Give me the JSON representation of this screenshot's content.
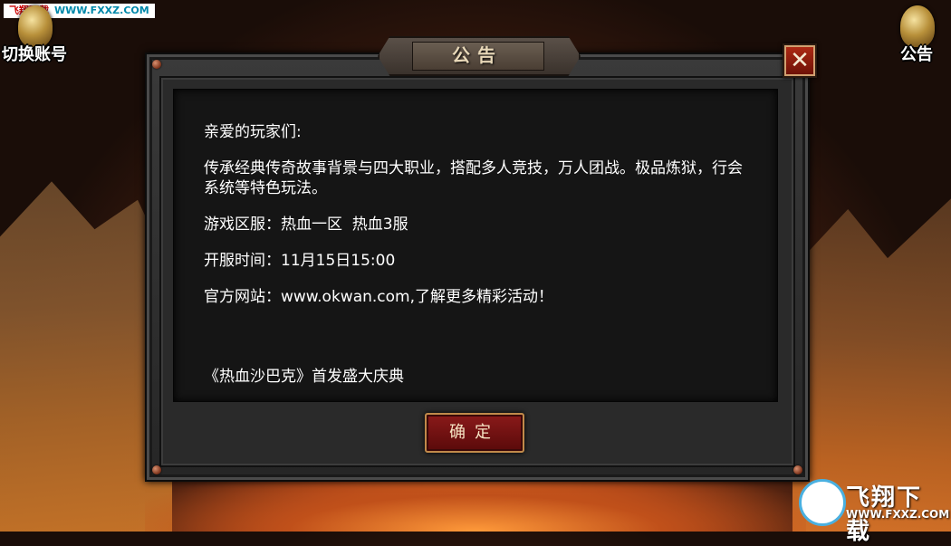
{
  "watermark": {
    "top_left_name": "飞翔下载",
    "top_left_url": "WWW.FXXZ.COM",
    "bottom_right_name": "飞翔下载",
    "bottom_right_url": "WWW.FXXZ.COM"
  },
  "corner_buttons": {
    "switch_account": "切换账号",
    "notice": "公告"
  },
  "dialog": {
    "title": "公告",
    "close_symbol": "✕",
    "paragraphs": [
      "亲爱的玩家们:",
      "传承经典传奇故事背景与四大职业，搭配多人竞技，万人团战。极品炼狱，行会系统等特色玩法。",
      "游戏区服：热血一区  热血3服",
      "开服时间：11月15日15:00",
      "官方网站：www.okwan.com,了解更多精彩活动！",
      "",
      "《热血沙巴克》首发盛大庆典"
    ],
    "confirm_label": "确定"
  }
}
